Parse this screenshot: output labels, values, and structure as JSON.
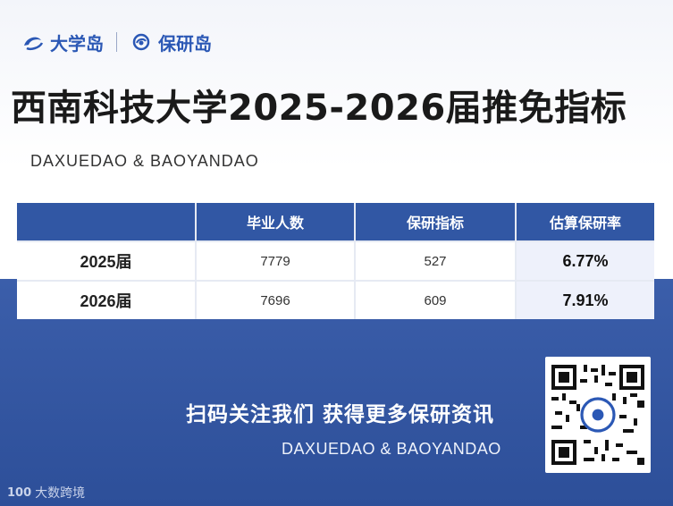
{
  "brand": {
    "logo_left": "大学岛",
    "logo_right": "保研岛"
  },
  "title": "西南科技大学2025-2026届推免指标",
  "subtitle": "DAXUEDAO & BAOYANDAO",
  "table": {
    "headers": [
      "",
      "毕业人数",
      "保研指标",
      "估算保研率"
    ],
    "rows": [
      [
        "2025届",
        "7779",
        "527",
        "6.77%"
      ],
      [
        "2026届",
        "7696",
        "609",
        "7.91%"
      ]
    ]
  },
  "cta": {
    "text": "扫码关注我们 获得更多保研资讯",
    "sub": "DAXUEDAO & BAOYANDAO"
  },
  "watermark": {
    "mark": "100",
    "text": "大数跨境"
  },
  "colors": {
    "brand_blue": "#2b58b5",
    "header_blue": "#3157a4",
    "band_blue": "#3b5eaa"
  },
  "icons": [
    "daxuedao-logo-icon",
    "baoyandao-logo-icon",
    "qr-code-icon",
    "watermark-logo-icon"
  ]
}
